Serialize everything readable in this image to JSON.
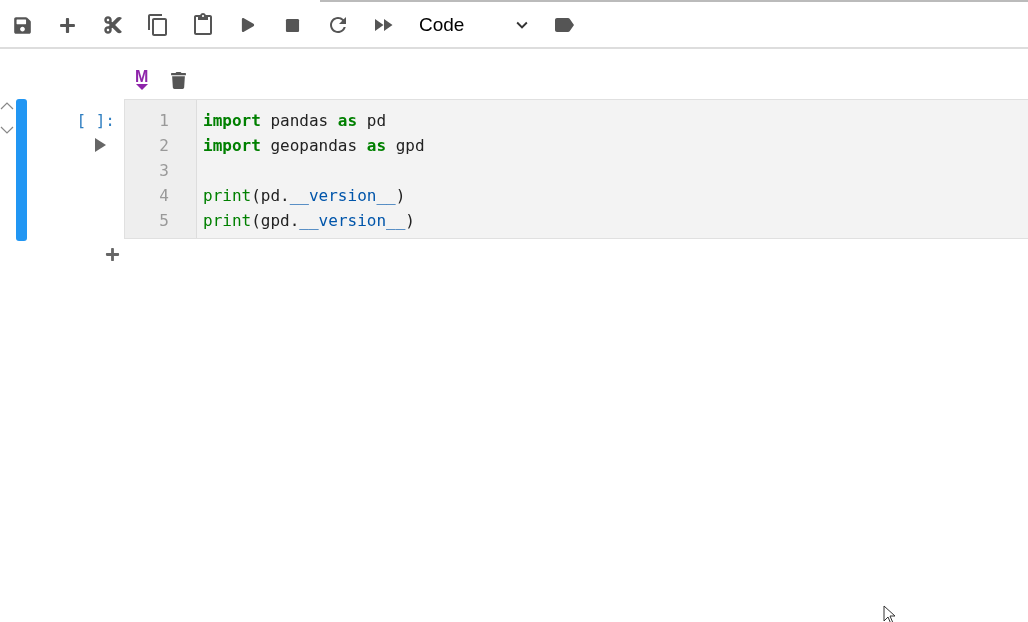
{
  "toolbar": {
    "buttons": [
      {
        "kind": "save"
      },
      {
        "kind": "add"
      },
      {
        "kind": "cut"
      },
      {
        "kind": "copy"
      },
      {
        "kind": "paste"
      },
      {
        "kind": "run"
      },
      {
        "kind": "stop"
      },
      {
        "kind": "restart"
      },
      {
        "kind": "run-all"
      }
    ],
    "cell_type": "Code"
  },
  "cell": {
    "markdown_toggle": "M",
    "prompt": "[ ]:",
    "active": true,
    "lines": [
      {
        "number": "1",
        "tokens": [
          {
            "kind": "keyword",
            "text": "import"
          },
          {
            "kind": "plain",
            "text": " pandas "
          },
          {
            "kind": "keyword",
            "text": "as"
          },
          {
            "kind": "plain",
            "text": " pd"
          }
        ]
      },
      {
        "number": "2",
        "tokens": [
          {
            "kind": "keyword",
            "text": "import"
          },
          {
            "kind": "plain",
            "text": " geopandas "
          },
          {
            "kind": "keyword",
            "text": "as"
          },
          {
            "kind": "plain",
            "text": " gpd"
          }
        ]
      },
      {
        "number": "3"
      },
      {
        "number": "4",
        "tokens": [
          {
            "kind": "builtin",
            "text": "print"
          },
          {
            "kind": "plain",
            "text": "(pd."
          },
          {
            "kind": "attr",
            "text": "__version__"
          },
          {
            "kind": "plain",
            "text": ")"
          }
        ]
      },
      {
        "number": "5",
        "tokens": [
          {
            "kind": "builtin",
            "text": "print"
          },
          {
            "kind": "plain",
            "text": "(gpd."
          },
          {
            "kind": "attr",
            "text": "__version__"
          },
          {
            "kind": "plain",
            "text": ")"
          }
        ]
      }
    ]
  }
}
